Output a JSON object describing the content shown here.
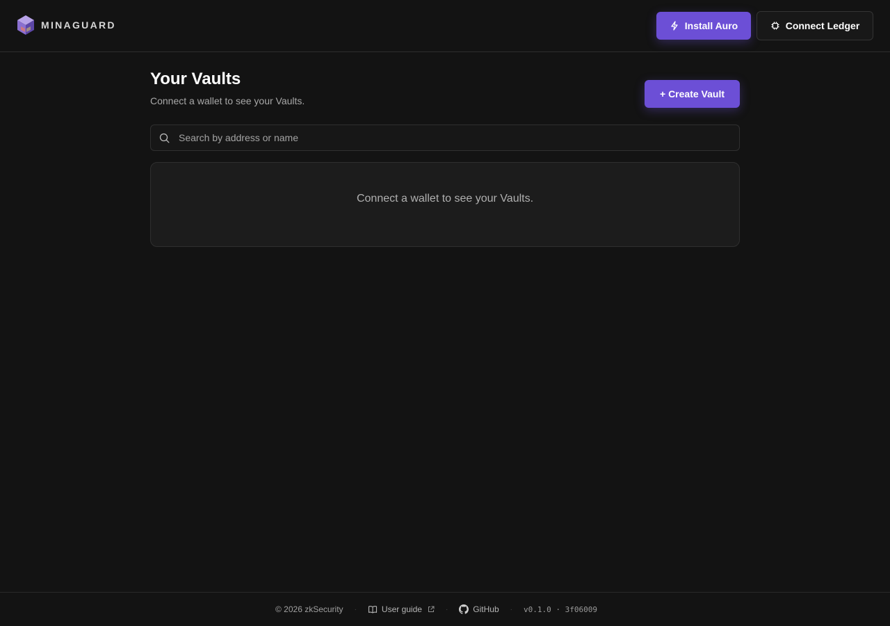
{
  "header": {
    "brand_name": "MINAGUARD",
    "install_button": {
      "label": "Install Auro",
      "icon": "bolt-icon"
    },
    "ledger_button": {
      "label": "Connect Ledger",
      "icon": "chip-icon"
    }
  },
  "main": {
    "title": "Your Vaults",
    "subtitle": "Connect a wallet to see your Vaults.",
    "create_button_label": "+ Create Vault",
    "search": {
      "placeholder": "Search by address or name",
      "value": "",
      "icon": "search-icon"
    },
    "empty_message": "Connect a wallet to see your Vaults."
  },
  "footer": {
    "copyright": "© 2026 zkSecurity",
    "user_guide_label": "User guide",
    "github_label": "GitHub",
    "version": "v0.1.0 · 3f06009",
    "separator": "·"
  },
  "colors": {
    "background": "#131313",
    "accent": "#6c4fd6",
    "border": "#2e2e2e",
    "card": "#1c1c1c"
  }
}
